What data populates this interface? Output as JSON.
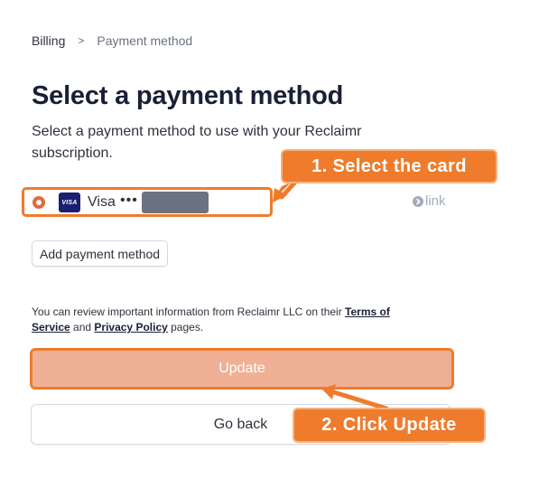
{
  "breadcrumb": {
    "parent": "Billing",
    "separator": ">",
    "current": "Payment method"
  },
  "page": {
    "title": "Select a payment method",
    "subtitle": "Select a payment method to use with your Reclaimr subscription."
  },
  "payment_methods": [
    {
      "brand_label": "VISA",
      "brand": "Visa",
      "dots": "•••",
      "last4": "",
      "selected": true
    }
  ],
  "link_badge": {
    "icon": "chevron-right-icon",
    "label": "link"
  },
  "add_payment_method_label": "Add payment method",
  "terms": {
    "prefix": "You can review important information from Reclaimr LLC on their ",
    "terms_link": "Terms of Service",
    "and": " and ",
    "privacy_link": "Privacy Policy",
    "suffix": " pages."
  },
  "buttons": {
    "update": "Update",
    "go_back": "Go back"
  },
  "annotations": {
    "step1": "1. Select the card",
    "step2": "2. Click Update"
  },
  "colors": {
    "accent": "#ee7c2c",
    "update_fill": "#efb096",
    "text": "#1a1f36",
    "muted": "#6b7280"
  }
}
